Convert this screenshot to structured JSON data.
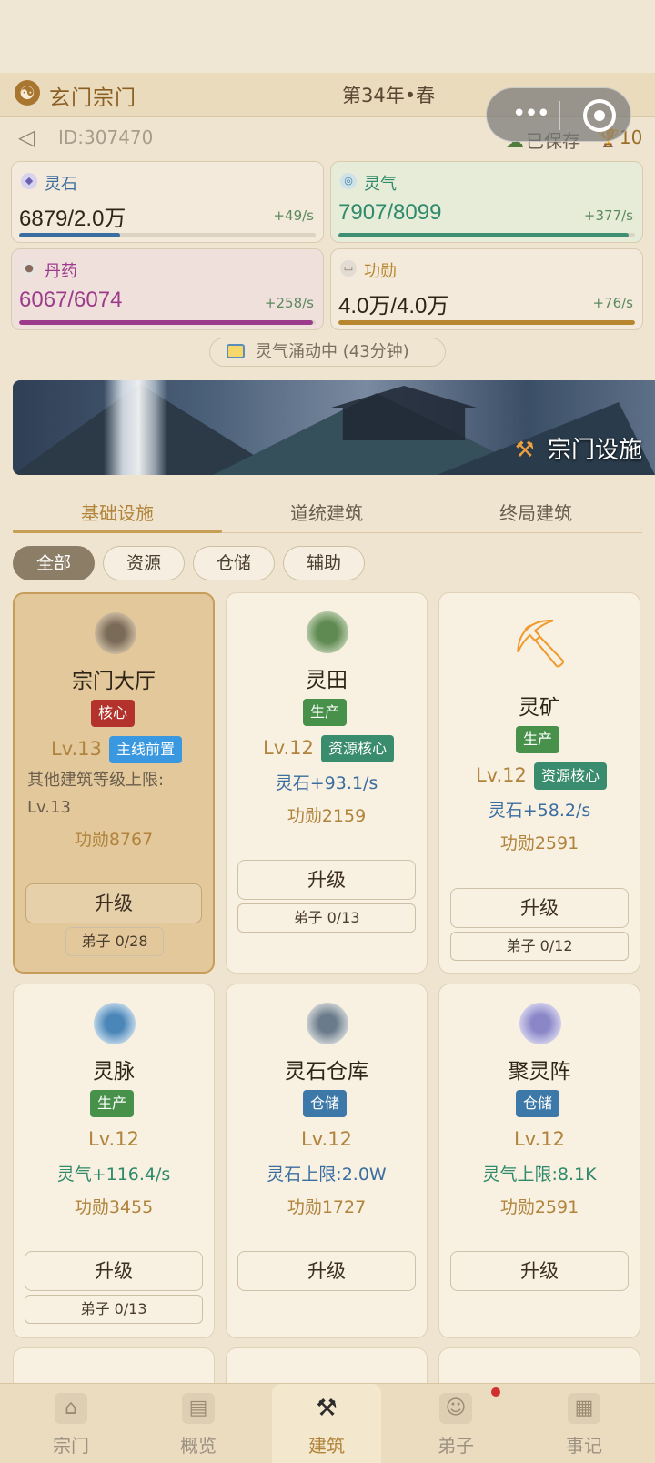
{
  "header": {
    "sect_name": "玄门宗门",
    "year": "第34年•春",
    "id_text": "ID:307470",
    "saved": "已保存",
    "trophy_count": "10"
  },
  "resources": [
    {
      "label": "灵石",
      "value": "6879/2.0万",
      "rate": "+49/s",
      "fill": 0.34,
      "color": "#3b6ea0"
    },
    {
      "label": "灵气",
      "value": "7907/8099",
      "rate": "+377/s",
      "fill": 0.98,
      "color": "#3f8f72"
    },
    {
      "label": "丹药",
      "value": "6067/6074",
      "rate": "+258/s",
      "fill": 0.99,
      "color": "#9c3b8c"
    },
    {
      "label": "功勋",
      "value": "4.0万/4.0万",
      "rate": "+76/s",
      "fill": 1.0,
      "color": "#b8862f"
    }
  ],
  "status_pill": "灵气涌动中 (43分钟)",
  "banner": {
    "title": "宗门设施"
  },
  "tabs": [
    "基础设施",
    "道统建筑",
    "终局建筑"
  ],
  "chips": [
    "全部",
    "资源",
    "仓储",
    "辅助"
  ],
  "buildings": [
    {
      "name": "宗门大厅",
      "tag": "核心",
      "level": "Lv.13",
      "extra_tag": "主线前置",
      "desc1": "其他建筑等级上限:",
      "desc2": "Lv.13",
      "merit": "功勋8767",
      "upgrade": "升级",
      "disciples": "弟子 0/28"
    },
    {
      "name": "灵田",
      "tag": "生产",
      "level": "Lv.12",
      "extra_tag": "资源核心",
      "production": "灵石+93.1/s",
      "merit": "功勋2159",
      "upgrade": "升级",
      "disciples": "弟子 0/13"
    },
    {
      "name": "灵矿",
      "tag": "生产",
      "level": "Lv.12",
      "extra_tag": "资源核心",
      "production": "灵石+58.2/s",
      "merit": "功勋2591",
      "upgrade": "升级",
      "disciples": "弟子 0/12"
    },
    {
      "name": "灵脉",
      "tag": "生产",
      "level": "Lv.12",
      "production": "灵气+116.4/s",
      "merit": "功勋3455",
      "upgrade": "升级",
      "disciples": "弟子 0/13"
    },
    {
      "name": "灵石仓库",
      "tag": "仓储",
      "level": "Lv.12",
      "production": "灵石上限:2.0W",
      "merit": "功勋1727",
      "upgrade": "升级"
    },
    {
      "name": "聚灵阵",
      "tag": "仓储",
      "level": "Lv.12",
      "production": "灵气上限:8.1K",
      "merit": "功勋2591",
      "upgrade": "升级"
    }
  ],
  "nav": [
    "宗门",
    "概览",
    "建筑",
    "弟子",
    "事记"
  ],
  "colors": {
    "accent": "#b1843a",
    "background": "#efe4cf",
    "card": "#f8f0e1",
    "highlight_card": "#e2c89b"
  }
}
